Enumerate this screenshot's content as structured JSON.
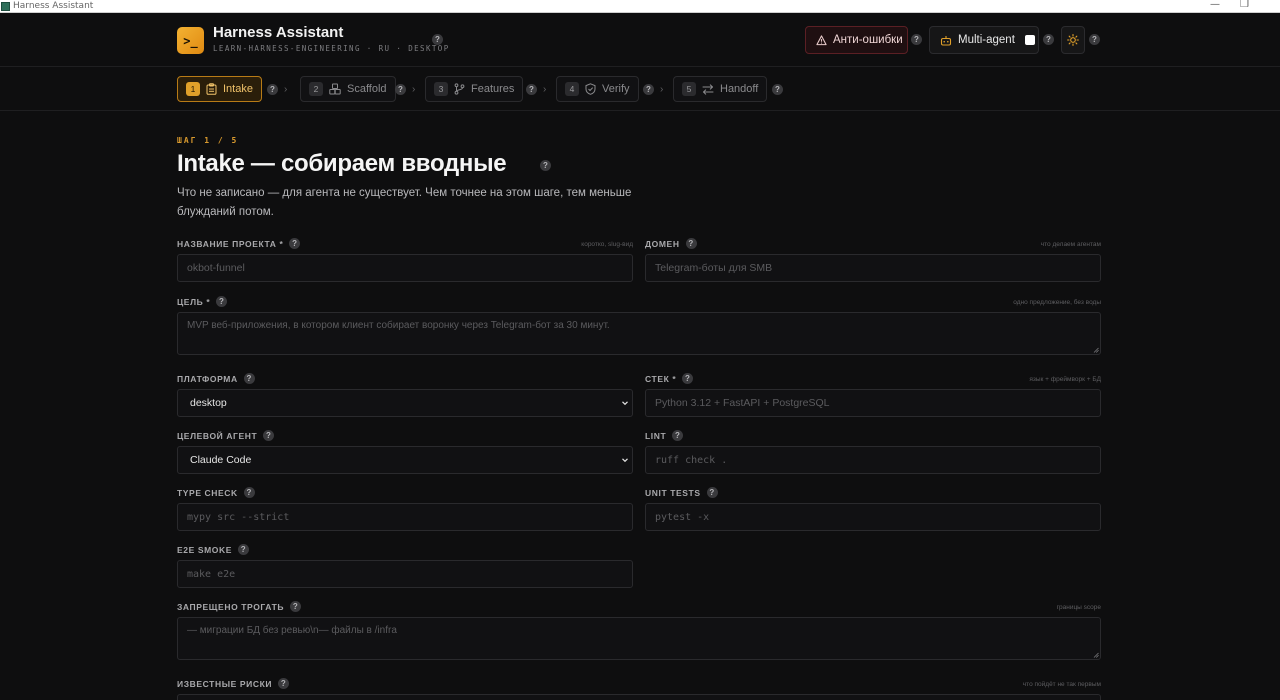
{
  "window": {
    "title": "Harness Assistant",
    "minimize": "—",
    "restore": "❐"
  },
  "header": {
    "logo": ">_",
    "title": "Harness Assistant",
    "subtitle": "LEARN-HARNESS-ENGINEERING · RU · DESKTOP",
    "anti_errors_label": "Анти-ошибки",
    "multi_agent_label": "Multi-agent",
    "multi_agent_checked": false,
    "help_glyph": "?"
  },
  "steps": [
    {
      "num": "1",
      "label": "Intake",
      "icon": "clipboard-icon",
      "active": true
    },
    {
      "num": "2",
      "label": "Scaffold",
      "icon": "scaffold-icon",
      "active": false
    },
    {
      "num": "3",
      "label": "Features",
      "icon": "branch-icon",
      "active": false
    },
    {
      "num": "4",
      "label": "Verify",
      "icon": "shield-icon",
      "active": false
    },
    {
      "num": "5",
      "label": "Handoff",
      "icon": "swap-icon",
      "active": false
    }
  ],
  "main": {
    "kicker": "ШАГ 1 / 5",
    "title": "Intake — собираем вводные",
    "description": "Что не записано — для агента не существует. Чем точнее на этом шаге, тем меньше блужданий потом."
  },
  "form": {
    "project_name": {
      "label": "НАЗВАНИЕ ПРОЕКТА *",
      "hint": "коротко, slug-вид",
      "placeholder": "okbot-funnel"
    },
    "domain": {
      "label": "ДОМЕН",
      "hint": "что делаем агентам",
      "placeholder": "Telegram-боты для SMB"
    },
    "goal": {
      "label": "ЦЕЛЬ *",
      "hint": "одно предложение, без воды",
      "placeholder": "MVP веб-приложения, в котором клиент собирает воронку через Telegram-бот за 30 минут."
    },
    "platform": {
      "label": "ПЛАТФОРМА",
      "value": "desktop"
    },
    "stack": {
      "label": "СТЕК *",
      "hint": "язык + фреймворк + БД",
      "placeholder": "Python 3.12 + FastAPI + PostgreSQL"
    },
    "target_agent": {
      "label": "ЦЕЛЕВОЙ АГЕНТ",
      "value": "Claude Code"
    },
    "lint": {
      "label": "LINT",
      "placeholder": "ruff check ."
    },
    "type_check": {
      "label": "TYPE CHECK",
      "placeholder": "mypy src --strict"
    },
    "unit_tests": {
      "label": "UNIT TESTS",
      "placeholder": "pytest -x"
    },
    "e2e_smoke": {
      "label": "E2E SMOKE",
      "placeholder": "make e2e"
    },
    "forbidden": {
      "label": "ЗАПРЕЩЕНО ТРОГАТЬ",
      "hint": "границы scope",
      "placeholder": "— миграции БД без ревью\\n— файлы в /infra"
    },
    "risks": {
      "label": "ИЗВЕСТНЫЕ РИСКИ",
      "hint": "что пойдёт не так первым"
    }
  }
}
